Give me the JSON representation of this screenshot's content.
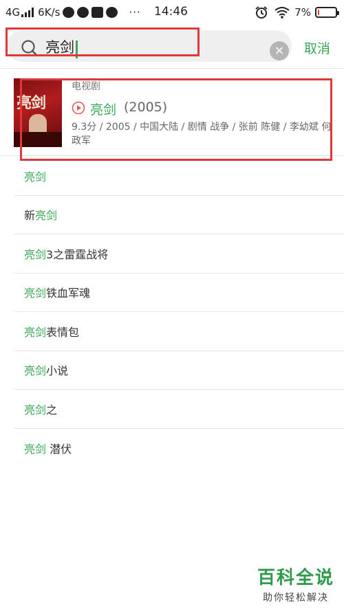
{
  "status_bar": {
    "network": "4G",
    "speed": "6K/s",
    "time": "14:46",
    "battery": "7%",
    "battery_level": 0.07,
    "battery_color": "#e53935",
    "more": "···"
  },
  "search": {
    "query": "亮剑",
    "placeholder": "",
    "cancel_label": "取消",
    "clear_icon": "×"
  },
  "result": {
    "type_label": "电视剧",
    "title": "亮剑",
    "year": "(2005)",
    "meta": "9.3分 / 2005 / 中国大陆 / 剧情 战争 / 张前 陈健 / 李幼斌 何政军",
    "poster_text": "亮剑"
  },
  "suggestions": [
    {
      "match": "亮剑",
      "rest": ""
    },
    {
      "prefix": "新",
      "match": "亮剑",
      "rest": ""
    },
    {
      "match": "亮剑",
      "rest": "3之雷霆战将"
    },
    {
      "match": "亮剑",
      "rest": "铁血军魂"
    },
    {
      "match": "亮剑",
      "rest": "表情包"
    },
    {
      "match": "亮剑",
      "rest": "小说"
    },
    {
      "match": "亮剑",
      "rest": "之"
    },
    {
      "match": "亮剑",
      "rest": " 潜伏"
    }
  ],
  "watermark": {
    "main": "百科全说",
    "sub": "助你轻松解决"
  },
  "colors": {
    "accent": "#3aa757",
    "highlight_box": "#e03838"
  }
}
